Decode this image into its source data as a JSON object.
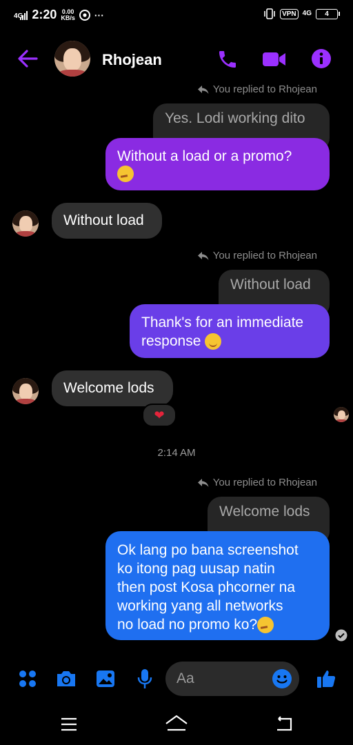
{
  "status_bar": {
    "network_left": "4G",
    "time": "2:20",
    "speed_value": "0.00",
    "speed_unit": "KB/s",
    "more": "···",
    "vpn": "VPN",
    "network_right": "4G",
    "battery": "4"
  },
  "header": {
    "contact_name": "Rhojean",
    "back_icon": "arrow-left-icon",
    "call_icon": "phone-icon",
    "video_icon": "video-camera-icon",
    "info_icon": "info-icon"
  },
  "messages": {
    "reply_note_1": "You replied to Rhojean",
    "quoted_1": "Yes. Lodi working dito",
    "out_1": "Without a load or a promo?",
    "in_1": "Without load",
    "reply_note_2": "You replied to Rhojean",
    "quoted_2": "Without load",
    "out_2_line1": "Thank's for an immediate",
    "out_2_line2": "response",
    "in_2": "Welcome lods",
    "reaction": "❤",
    "time_separator": "2:14 AM",
    "reply_note_3": "You replied to Rhojean",
    "quoted_3": "Welcome lods",
    "out_3_line1": "Ok lang po bana screenshot",
    "out_3_line2": "ko itong pag uusap natin",
    "out_3_line3": "then post Kosa phcorner na",
    "out_3_line4": "working yang all networks",
    "out_3_line5": "no load no promo ko?"
  },
  "composer": {
    "placeholder": "Aa",
    "icons": [
      "apps-icon",
      "camera-icon",
      "gallery-icon",
      "microphone-icon",
      "emoji-icon",
      "like-icon"
    ]
  },
  "colors": {
    "accent_purple": "#8a2be2",
    "bubble_violet": "#6a3ee8",
    "bubble_blue": "#1f6ff0",
    "composer_blue": "#1877f2"
  }
}
